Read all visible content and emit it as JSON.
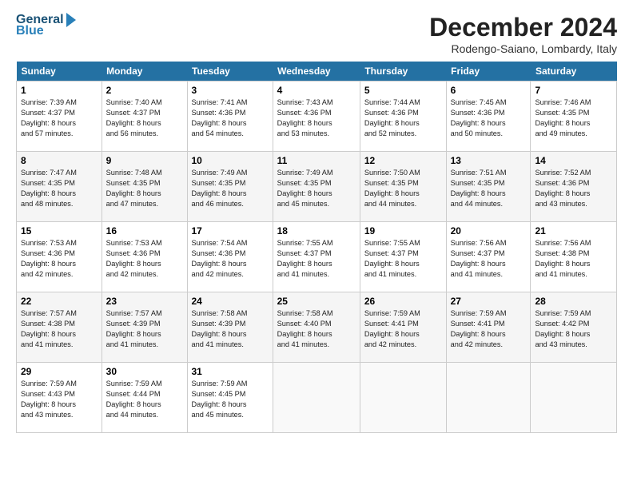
{
  "logo": {
    "line1": "General",
    "line2": "Blue",
    "arrow": "▶"
  },
  "title": "December 2024",
  "location": "Rodengo-Saiano, Lombardy, Italy",
  "days_header": [
    "Sunday",
    "Monday",
    "Tuesday",
    "Wednesday",
    "Thursday",
    "Friday",
    "Saturday"
  ],
  "weeks": [
    [
      {
        "day": "1",
        "info": "Sunrise: 7:39 AM\nSunset: 4:37 PM\nDaylight: 8 hours\nand 57 minutes."
      },
      {
        "day": "2",
        "info": "Sunrise: 7:40 AM\nSunset: 4:37 PM\nDaylight: 8 hours\nand 56 minutes."
      },
      {
        "day": "3",
        "info": "Sunrise: 7:41 AM\nSunset: 4:36 PM\nDaylight: 8 hours\nand 54 minutes."
      },
      {
        "day": "4",
        "info": "Sunrise: 7:43 AM\nSunset: 4:36 PM\nDaylight: 8 hours\nand 53 minutes."
      },
      {
        "day": "5",
        "info": "Sunrise: 7:44 AM\nSunset: 4:36 PM\nDaylight: 8 hours\nand 52 minutes."
      },
      {
        "day": "6",
        "info": "Sunrise: 7:45 AM\nSunset: 4:36 PM\nDaylight: 8 hours\nand 50 minutes."
      },
      {
        "day": "7",
        "info": "Sunrise: 7:46 AM\nSunset: 4:35 PM\nDaylight: 8 hours\nand 49 minutes."
      }
    ],
    [
      {
        "day": "8",
        "info": "Sunrise: 7:47 AM\nSunset: 4:35 PM\nDaylight: 8 hours\nand 48 minutes."
      },
      {
        "day": "9",
        "info": "Sunrise: 7:48 AM\nSunset: 4:35 PM\nDaylight: 8 hours\nand 47 minutes."
      },
      {
        "day": "10",
        "info": "Sunrise: 7:49 AM\nSunset: 4:35 PM\nDaylight: 8 hours\nand 46 minutes."
      },
      {
        "day": "11",
        "info": "Sunrise: 7:49 AM\nSunset: 4:35 PM\nDaylight: 8 hours\nand 45 minutes."
      },
      {
        "day": "12",
        "info": "Sunrise: 7:50 AM\nSunset: 4:35 PM\nDaylight: 8 hours\nand 44 minutes."
      },
      {
        "day": "13",
        "info": "Sunrise: 7:51 AM\nSunset: 4:35 PM\nDaylight: 8 hours\nand 44 minutes."
      },
      {
        "day": "14",
        "info": "Sunrise: 7:52 AM\nSunset: 4:36 PM\nDaylight: 8 hours\nand 43 minutes."
      }
    ],
    [
      {
        "day": "15",
        "info": "Sunrise: 7:53 AM\nSunset: 4:36 PM\nDaylight: 8 hours\nand 42 minutes."
      },
      {
        "day": "16",
        "info": "Sunrise: 7:53 AM\nSunset: 4:36 PM\nDaylight: 8 hours\nand 42 minutes."
      },
      {
        "day": "17",
        "info": "Sunrise: 7:54 AM\nSunset: 4:36 PM\nDaylight: 8 hours\nand 42 minutes."
      },
      {
        "day": "18",
        "info": "Sunrise: 7:55 AM\nSunset: 4:37 PM\nDaylight: 8 hours\nand 41 minutes."
      },
      {
        "day": "19",
        "info": "Sunrise: 7:55 AM\nSunset: 4:37 PM\nDaylight: 8 hours\nand 41 minutes."
      },
      {
        "day": "20",
        "info": "Sunrise: 7:56 AM\nSunset: 4:37 PM\nDaylight: 8 hours\nand 41 minutes."
      },
      {
        "day": "21",
        "info": "Sunrise: 7:56 AM\nSunset: 4:38 PM\nDaylight: 8 hours\nand 41 minutes."
      }
    ],
    [
      {
        "day": "22",
        "info": "Sunrise: 7:57 AM\nSunset: 4:38 PM\nDaylight: 8 hours\nand 41 minutes."
      },
      {
        "day": "23",
        "info": "Sunrise: 7:57 AM\nSunset: 4:39 PM\nDaylight: 8 hours\nand 41 minutes."
      },
      {
        "day": "24",
        "info": "Sunrise: 7:58 AM\nSunset: 4:39 PM\nDaylight: 8 hours\nand 41 minutes."
      },
      {
        "day": "25",
        "info": "Sunrise: 7:58 AM\nSunset: 4:40 PM\nDaylight: 8 hours\nand 41 minutes."
      },
      {
        "day": "26",
        "info": "Sunrise: 7:59 AM\nSunset: 4:41 PM\nDaylight: 8 hours\nand 42 minutes."
      },
      {
        "day": "27",
        "info": "Sunrise: 7:59 AM\nSunset: 4:41 PM\nDaylight: 8 hours\nand 42 minutes."
      },
      {
        "day": "28",
        "info": "Sunrise: 7:59 AM\nSunset: 4:42 PM\nDaylight: 8 hours\nand 43 minutes."
      }
    ],
    [
      {
        "day": "29",
        "info": "Sunrise: 7:59 AM\nSunset: 4:43 PM\nDaylight: 8 hours\nand 43 minutes."
      },
      {
        "day": "30",
        "info": "Sunrise: 7:59 AM\nSunset: 4:44 PM\nDaylight: 8 hours\nand 44 minutes."
      },
      {
        "day": "31",
        "info": "Sunrise: 7:59 AM\nSunset: 4:45 PM\nDaylight: 8 hours\nand 45 minutes."
      },
      {
        "day": "",
        "info": ""
      },
      {
        "day": "",
        "info": ""
      },
      {
        "day": "",
        "info": ""
      },
      {
        "day": "",
        "info": ""
      }
    ]
  ]
}
